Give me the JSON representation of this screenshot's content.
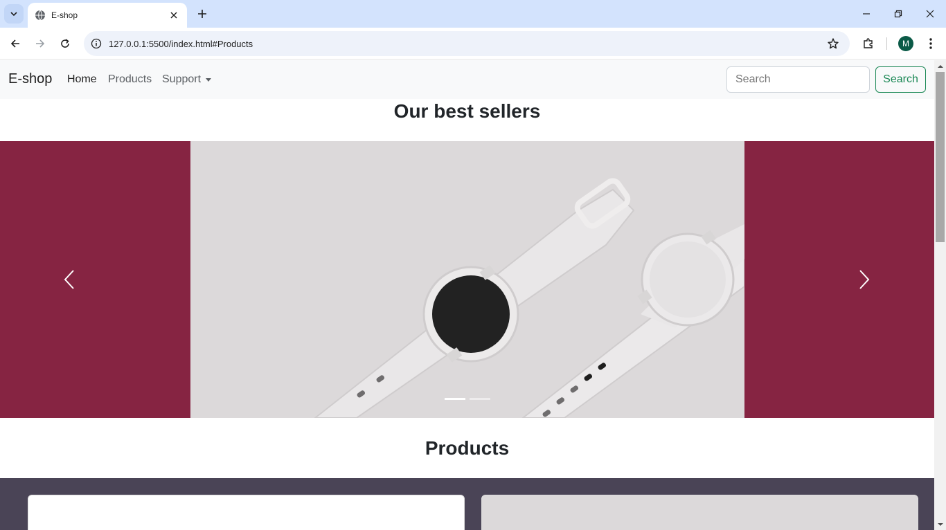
{
  "browser": {
    "tab_title": "E-shop",
    "url": "127.0.0.1:5500/index.html#Products",
    "profile_initial": "M"
  },
  "navbar": {
    "brand": "E-shop",
    "links": [
      "Home",
      "Products",
      "Support"
    ],
    "search_placeholder": "Search",
    "search_button": "Search"
  },
  "sections": {
    "best_sellers_title": "Our best sellers",
    "products_title": "Products"
  },
  "carousel": {
    "indicator_count": 2,
    "active_index": 0
  },
  "colors": {
    "carousel_bg": "#862442",
    "products_bg": "#4a4456",
    "search_button": "#198754"
  }
}
